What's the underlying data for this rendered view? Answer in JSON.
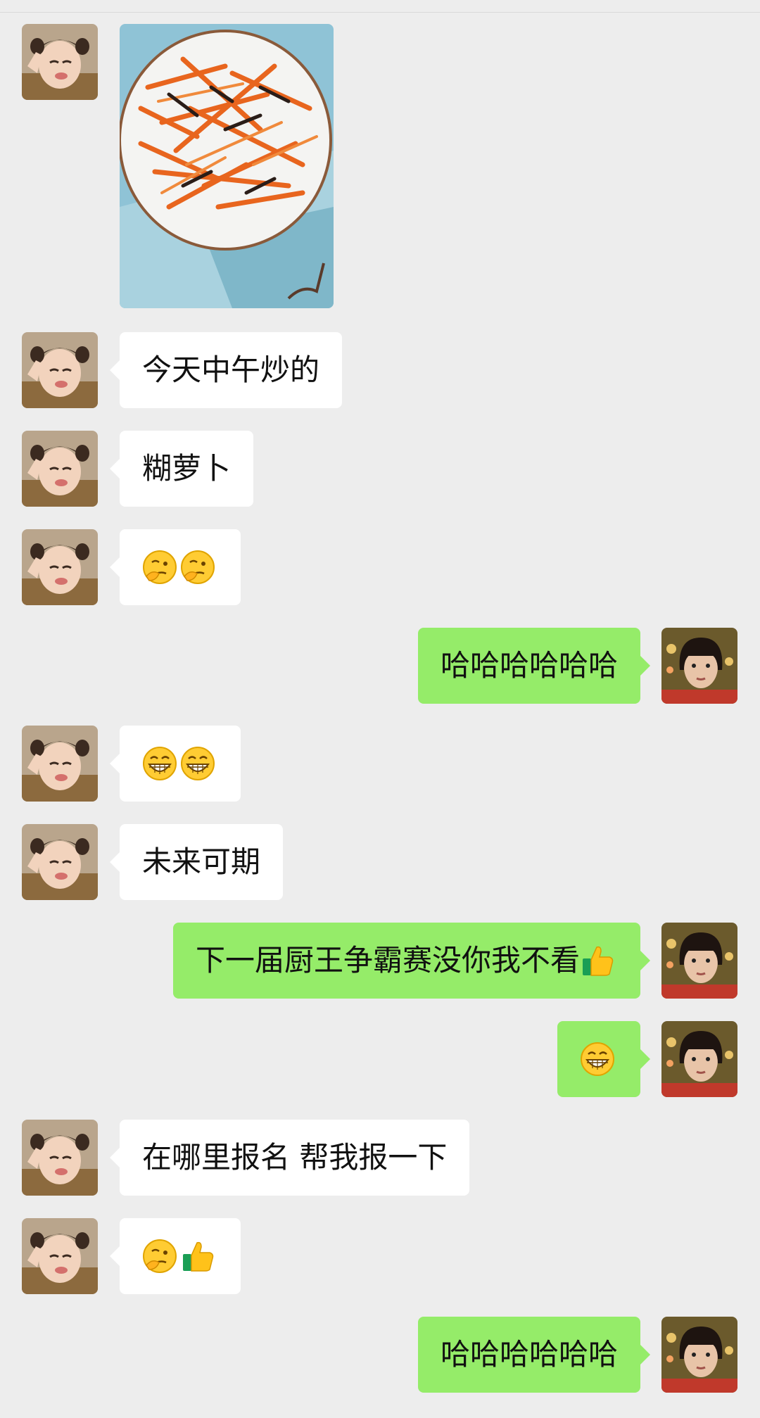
{
  "colors": {
    "background": "#ededed",
    "incoming_bubble": "#ffffff",
    "outgoing_bubble": "#95ec69"
  },
  "messages": [
    {
      "side": "in",
      "kind": "image",
      "description": "photo-plate-of-stir-fried-carrot"
    },
    {
      "side": "in",
      "kind": "text",
      "text": "今天中午炒的"
    },
    {
      "side": "in",
      "kind": "text",
      "text": "糊萝卜"
    },
    {
      "side": "in",
      "kind": "emoji",
      "emojis": [
        "thinking-face-emoji",
        "thinking-face-emoji"
      ]
    },
    {
      "side": "out",
      "kind": "text",
      "text": "哈哈哈哈哈哈"
    },
    {
      "side": "in",
      "kind": "emoji",
      "emojis": [
        "grin-emoji",
        "grin-emoji"
      ]
    },
    {
      "side": "in",
      "kind": "text",
      "text": "未来可期"
    },
    {
      "side": "out",
      "kind": "text",
      "text": "下一届厨王争霸赛没你我不看",
      "trailing_emoji": "thumbs-up-emoji"
    },
    {
      "side": "out",
      "kind": "emoji",
      "emojis": [
        "grin-emoji"
      ]
    },
    {
      "side": "in",
      "kind": "text",
      "text": "在哪里报名 帮我报一下"
    },
    {
      "side": "in",
      "kind": "emoji",
      "emojis": [
        "thinking-face-emoji",
        "thumbs-up-emoji"
      ]
    },
    {
      "side": "out",
      "kind": "text",
      "text": "哈哈哈哈哈哈"
    }
  ]
}
